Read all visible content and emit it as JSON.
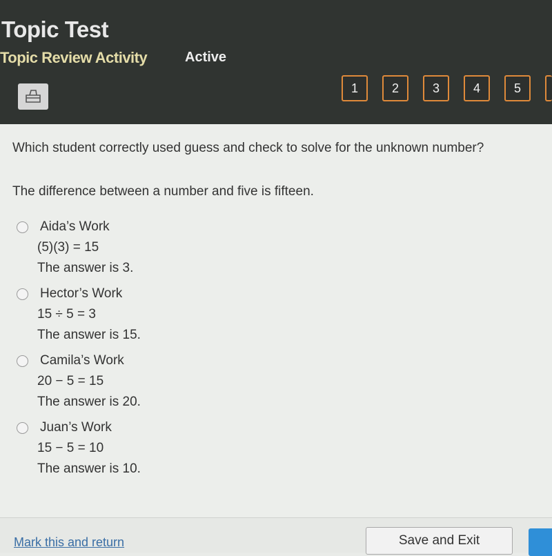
{
  "header": {
    "title": "Topic Test",
    "subtitle": "Topic Review Activity",
    "status": "Active",
    "print_icon": "printer-icon",
    "question_numbers": [
      "1",
      "2",
      "3",
      "4",
      "5"
    ],
    "accent_color": "#e08a3a"
  },
  "question": {
    "text": "Which student correctly used guess and check to solve for the unknown number?",
    "prompt": "The difference between a number and five is fifteen.",
    "options": [
      {
        "label": "Aida’s Work",
        "work": "(5)(3) = 15",
        "answer": "The answer is 3."
      },
      {
        "label": "Hector’s Work",
        "work": "15 ÷ 5 = 3",
        "answer": "The answer is 15."
      },
      {
        "label": "Camila’s Work",
        "work": "20 − 5 = 15",
        "answer": "The answer is 20."
      },
      {
        "label": "Juan’s Work",
        "work": "15 − 5 = 10",
        "answer": "The answer is 10."
      }
    ]
  },
  "footer": {
    "mark_link": "Mark this and return",
    "save_exit": "Save and Exit"
  }
}
